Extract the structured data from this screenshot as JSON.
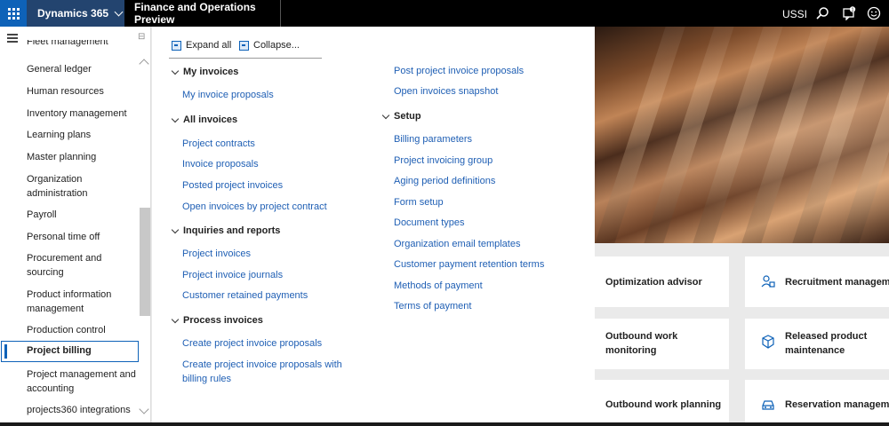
{
  "topbar": {
    "app_name": "Dynamics 365",
    "environment": "Finance and Operations Preview",
    "company": "USSI",
    "icons": [
      "waffle-icon",
      "chevron-down-icon",
      "search-icon",
      "notification-icon",
      "feedback-smile-icon"
    ]
  },
  "sidebar": {
    "partial_top": "Fleet management",
    "items": [
      "General ledger",
      "Human resources",
      "Inventory management",
      "Learning plans",
      "Master planning",
      "Organization administration",
      "Payroll",
      "Personal time off",
      "Procurement and sourcing",
      "Product information management",
      "Production control",
      "Project billing",
      "Project management and accounting",
      "projects360 integrations"
    ],
    "active": "Project billing"
  },
  "toolbar": {
    "expand_label": "Expand all",
    "collapse_label": "Collapse..."
  },
  "menu": {
    "my_invoices": {
      "title": "My invoices",
      "links": [
        "My invoice proposals"
      ]
    },
    "all_invoices": {
      "title": "All invoices",
      "links": [
        "Project contracts",
        "Invoice proposals",
        "Posted project invoices",
        "Open invoices by project contract"
      ]
    },
    "inquiries": {
      "title": "Inquiries and reports",
      "links": [
        "Project invoices",
        "Project invoice journals",
        "Customer retained payments"
      ]
    },
    "process": {
      "title": "Process invoices",
      "links": [
        "Create project invoice proposals",
        "Create project invoice proposals with billing rules"
      ]
    },
    "col2_top": [
      "Post project invoice proposals",
      "Open invoices snapshot"
    ],
    "setup": {
      "title": "Setup",
      "links": [
        "Billing parameters",
        "Project invoicing group",
        "Aging period definitions",
        "Form setup",
        "Document types",
        "Organization email templates",
        "Customer payment retention terms",
        "Methods of payment",
        "Terms of payment"
      ]
    }
  },
  "tiles": {
    "optimization": "Optimization advisor",
    "recruitment": "Recruitment managemer",
    "outbound_monitoring": "Outbound work monitoring",
    "released_product": "Released product maintenance",
    "outbound_planning": "Outbound work planning",
    "reservation": "Reservation managemen"
  },
  "colors": {
    "accent": "#0e62b8",
    "link": "#1f5fb4",
    "topbar": "#000000",
    "appname_bg": "#23446f"
  }
}
